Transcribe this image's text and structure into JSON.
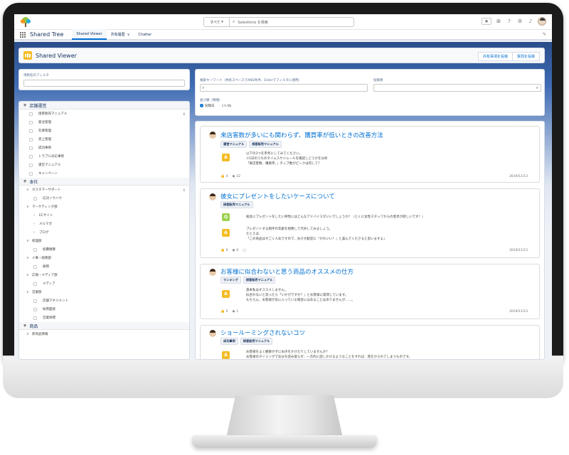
{
  "header": {
    "search_scope": "すべて",
    "search_placeholder": "Salesforce を検索"
  },
  "nav": {
    "app_name": "Shared Tree",
    "tabs": [
      "Shared Viewer",
      "共有履歴",
      "Chatter"
    ]
  },
  "page": {
    "title": "Shared Viewer",
    "buttons": [
      "共有事項を投稿",
      "質問を投稿"
    ]
  },
  "left_filter": {
    "label": "項目名のフィルタ"
  },
  "tree": {
    "sections": [
      {
        "name": "店舗運営",
        "count": "6",
        "items": [
          "接客販売マニュアル",
          "発注管理",
          "在庫管理",
          "売上管理",
          "成功事例",
          "トラブル対応事例",
          "運営マニュアル",
          "キャンペーン"
        ]
      },
      {
        "name": "本社",
        "count": "6",
        "items": [
          "カスタマーサポート",
          "応対ノウハウ",
          "マーケティング部",
          "ECサイト",
          "メルマガ",
          "ブログ",
          "経理部",
          "経費精算",
          "人事・総務部",
          "総務",
          "広報・メディア部",
          "メディア",
          "営業部",
          "店舗マネジメント",
          "採用面接",
          "営業目標"
        ]
      },
      {
        "name": "商品",
        "count": "",
        "items": [
          "新商品情報"
        ]
      }
    ]
  },
  "filters": {
    "keyword_label": "検索キーワード（共有スペースでAND条件、Enterでフィルタに適用）",
    "poster_label": "投稿者",
    "show_label": "並び順（降順）",
    "radio_options": [
      "投稿日",
      "いいね"
    ]
  },
  "items": [
    {
      "title": "来店客数が多いにも関わらず、購買率が低いときの改善方法",
      "tags": [
        "運営マニュアル",
        "接客販売マニュアル"
      ],
      "rows": [
        {
          "icon_color": "#f4bc25",
          "lines": [
            "以下の3つを参考にしてみてください。",
            "①1日のうちのタイムスケジュールを確認しどうかを分析",
            "「来店客数、購買率、」タップ数がピークは何して？"
          ]
        }
      ],
      "likes": "4",
      "views": "22",
      "date": "2019/11/13"
    },
    {
      "title": "彼女にプレゼントをしたいケースについて",
      "tags": [
        "接客販売マニュアル"
      ],
      "rows": [
        {
          "icon_color": "#9bd150",
          "lines": [
            "彼女にプレゼントをしたい男性にはどんなアドバイスがいいでしょうか？（とくに女性スタッフからの意見が欲しいです！）"
          ]
        },
        {
          "icon_color": "#f4bc25",
          "lines": [
            "プレゼントする相手の年齢を想像して代弁してみましょう。",
            "たとえば、",
            "「この商品はすごく人気ですので、おけ大歓迎に『かわいい！』と喜んでくださると思いますよ」"
          ]
        }
      ],
      "likes": "0",
      "views": "0",
      "date": "2019/11/13"
    },
    {
      "title": "お客様に似合わないと思う商品のオススメの仕方",
      "tags": [
        "ランキング",
        "接客販売マニュアル"
      ],
      "rows": [
        {
          "icon_color": "#f4bc25",
          "lines": [
            "基本私はオススメしません。",
            "似合わないと思ったら「いかがですか？」とお客様に質問しています。",
            "もちろん、お客様が気に入っている場合にはあることはありませんが……。"
          ]
        }
      ],
      "likes": "0",
      "views": "1",
      "date": "2019/11/13"
    },
    {
      "title": "ショールーミングされないコツ",
      "tags": [
        "成功事例",
        "接客販売マニュアル"
      ],
      "rows": [
        {
          "icon_color": "#f4bc25",
          "lines": [
            "お客様をよく観察せずにお声をかけたりしていませんか？",
            "お客様のタイミングで気分を読み取らず、一方的に話しかけるようなことをすれば、席をかられてしまうものです。"
          ]
        }
      ],
      "likes": "",
      "views": "",
      "date": ""
    }
  ]
}
